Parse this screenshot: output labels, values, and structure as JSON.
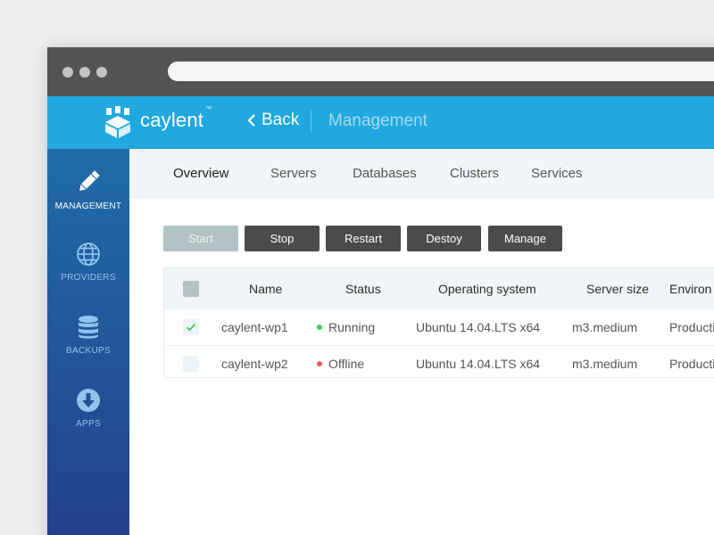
{
  "app": {
    "name": "caylent",
    "trademark": "™",
    "back_label": "Back",
    "section_title": "Management"
  },
  "sidebar": {
    "items": [
      {
        "label": "MANAGEMENT",
        "icon": "pencil-icon",
        "active": true
      },
      {
        "label": "PROVIDERS",
        "icon": "globe-icon",
        "active": false
      },
      {
        "label": "BACKUPS",
        "icon": "database-icon",
        "active": false
      },
      {
        "label": "APPS",
        "icon": "download-circle-icon",
        "active": false
      }
    ]
  },
  "tabs": [
    {
      "label": "Overview",
      "active": true
    },
    {
      "label": "Servers",
      "active": false
    },
    {
      "label": "Databases",
      "active": false
    },
    {
      "label": "Clusters",
      "active": false
    },
    {
      "label": "Services",
      "active": false
    }
  ],
  "actions": {
    "start": "Start",
    "stop": "Stop",
    "restart": "Restart",
    "destroy": "Destoy",
    "manage": "Manage"
  },
  "table": {
    "columns": [
      "Name",
      "Status",
      "Operating system",
      "Server size",
      "Environ"
    ],
    "rows": [
      {
        "checked": true,
        "name": "caylent-wp1",
        "status": "Running",
        "status_color": "#39d05c",
        "os": "Ubuntu 14.04.LTS x64",
        "size": "m3.medium",
        "environment": "Producti"
      },
      {
        "checked": false,
        "name": "caylent-wp2",
        "status": "Offline",
        "status_color": "#ee5a5a",
        "os": "Ubuntu 14.04.LTS x64",
        "size": "m3.medium",
        "environment": "Producti"
      }
    ]
  },
  "colors": {
    "accent": "#20a8df",
    "sidebar_top": "#1f6ca8",
    "sidebar_bottom": "#24408a",
    "button_dark": "#4b4b4b",
    "button_disabled": "#b2c3c6",
    "check": "#39d05c"
  }
}
